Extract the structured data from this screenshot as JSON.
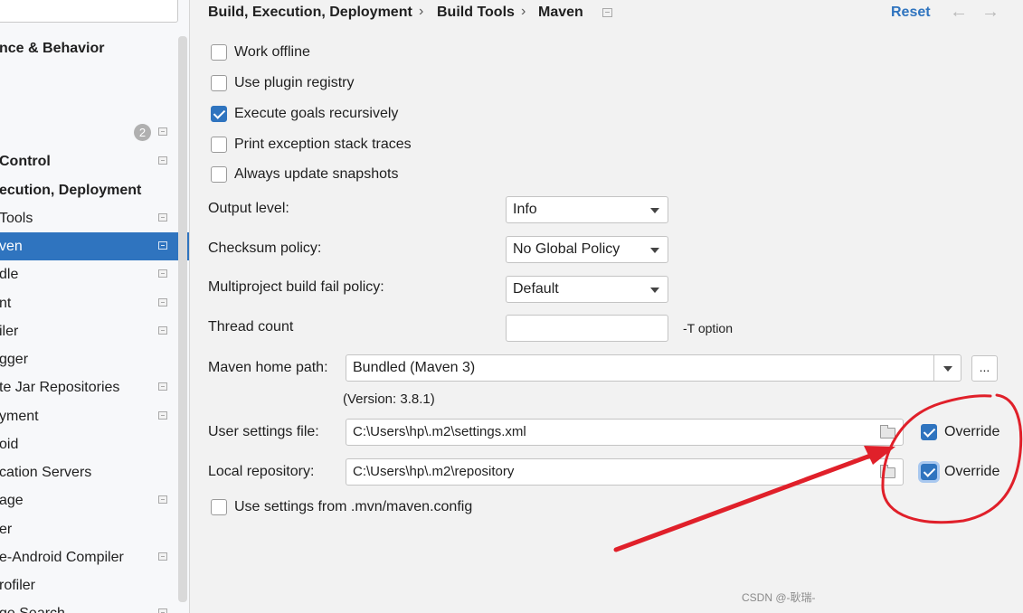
{
  "sidebar": {
    "items": [
      {
        "label": "nce & Behavior",
        "bold": true
      },
      {
        "label": "Control",
        "bold": true
      },
      {
        "label": "ecution, Deployment",
        "bold": true
      },
      {
        "label": "Tools"
      },
      {
        "label": "ven",
        "selected": true
      },
      {
        "label": "dle"
      },
      {
        "label": "nt"
      },
      {
        "label": "iler"
      },
      {
        "label": "gger"
      },
      {
        "label": "te Jar Repositories"
      },
      {
        "label": "yment"
      },
      {
        "label": "oid"
      },
      {
        "label": "cation Servers"
      },
      {
        "label": "age"
      },
      {
        "label": "er"
      },
      {
        "label": "e-Android Compiler"
      },
      {
        "label": "rofiler"
      },
      {
        "label": "ge Search"
      }
    ],
    "badge_count": "2"
  },
  "header": {
    "breadcrumb": [
      "Build, Execution, Deployment",
      "Build Tools",
      "Maven"
    ],
    "separator": "›",
    "reset_label": "Reset",
    "back_arrow": "←",
    "forward_arrow": "→"
  },
  "options": {
    "work_offline": {
      "label": "Work offline",
      "checked": false
    },
    "use_plugin_registry": {
      "label": "Use plugin registry",
      "checked": false
    },
    "execute_goals_recursively": {
      "label": "Execute goals recursively",
      "checked": true
    },
    "print_exception_stack_traces": {
      "label": "Print exception stack traces",
      "checked": false
    },
    "always_update_snapshots": {
      "label": "Always update snapshots",
      "checked": false
    }
  },
  "form": {
    "output_level": {
      "label": "Output level:",
      "value": "Info"
    },
    "checksum_policy": {
      "label": "Checksum policy:",
      "value": "No Global Policy"
    },
    "multiproject_policy": {
      "label": "Multiproject build fail policy:",
      "value": "Default"
    },
    "thread_count": {
      "label": "Thread count",
      "value": "",
      "hint": "-T option"
    },
    "maven_home": {
      "label": "Maven home path:",
      "value": "Bundled (Maven 3)",
      "browse": "...",
      "version": "(Version: 3.8.1)"
    },
    "user_settings": {
      "label": "User settings file:",
      "value": "C:\\Users\\hp\\.m2\\settings.xml",
      "override_label": "Override",
      "override_checked": true
    },
    "local_repository": {
      "label": "Local repository:",
      "value": "C:\\Users\\hp\\.m2\\repository",
      "override_label": "Override",
      "override_checked": true
    },
    "use_mvn_config": {
      "label": "Use settings from .mvn/maven.config",
      "checked": false
    }
  },
  "watermark": "CSDN @-耿瑞-",
  "colors": {
    "accent": "#2f74bf",
    "annotation": "#e0202a"
  }
}
